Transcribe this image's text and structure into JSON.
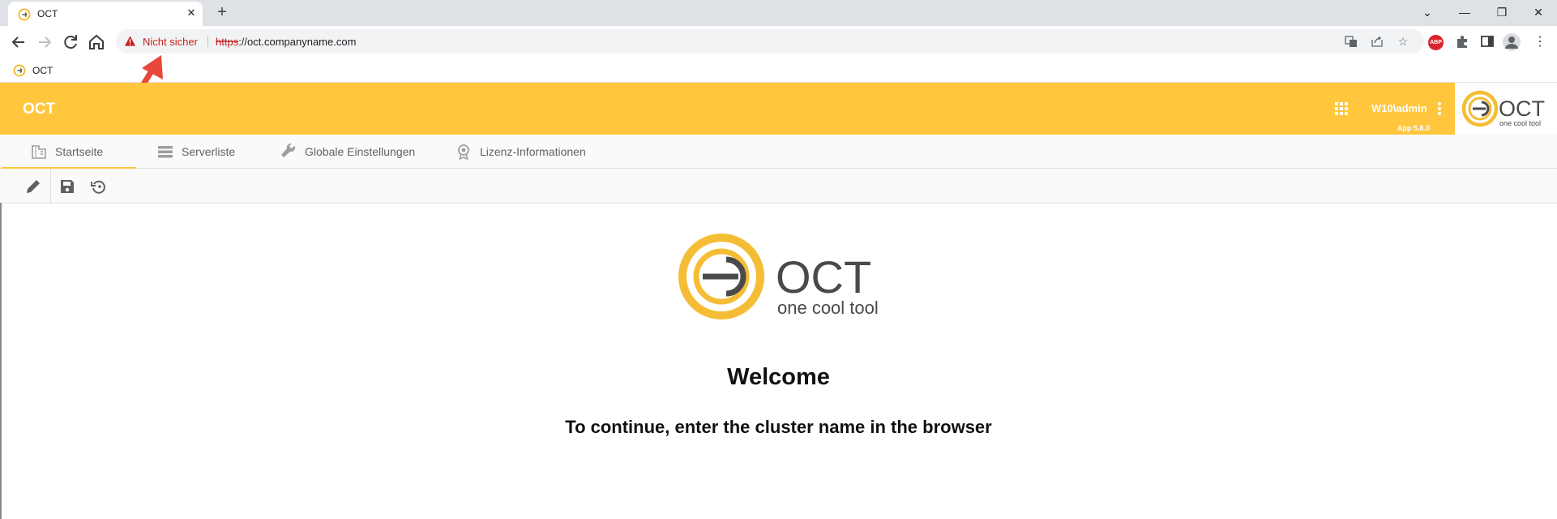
{
  "browser": {
    "tab": {
      "title": "OCT"
    },
    "window_controls": {
      "dropdown": "⌄",
      "minimize": "—",
      "restore": "❐",
      "close": "✕"
    },
    "address": {
      "security_label": "Nicht sicher",
      "url_protocol": "https",
      "url_rest": "://oct.companyname.com"
    },
    "bookmarks": [
      {
        "label": "OCT"
      }
    ]
  },
  "app": {
    "title": "OCT",
    "user": "W10\\admin",
    "version": "App 5.8.0",
    "brand_color": "#ffc63e",
    "logo": {
      "wordmark": "OCT",
      "tagline": "one cool tool"
    },
    "tabs": [
      {
        "label": "Startseite",
        "icon": "building-icon",
        "active": true
      },
      {
        "label": "Serverliste",
        "icon": "server-list-icon",
        "active": false
      },
      {
        "label": "Globale Einstellungen",
        "icon": "wrench-icon",
        "active": false
      },
      {
        "label": "Lizenz-Informationen",
        "icon": "license-badge-icon",
        "active": false
      }
    ],
    "actions": [
      "edit-icon",
      "save-icon",
      "restore-icon"
    ]
  },
  "main": {
    "heading": "Welcome",
    "subheading": "To continue, enter the cluster name in the browser"
  }
}
